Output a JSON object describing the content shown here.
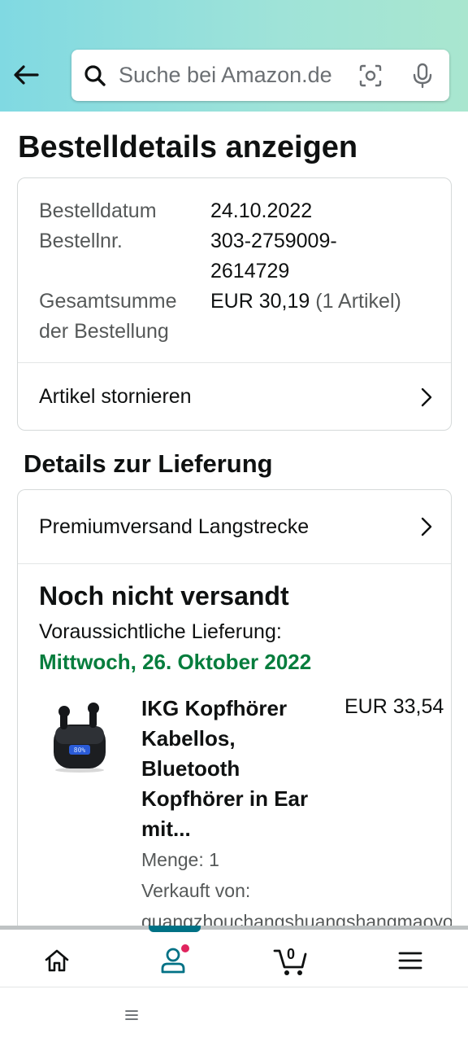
{
  "header": {
    "search_placeholder": "Suche bei Amazon.de"
  },
  "page": {
    "title": "Bestelldetails anzeigen"
  },
  "order_info": {
    "date_label": "Bestelldatum",
    "date_value": "24.10.2022",
    "number_label": "Bestellnr.",
    "number_value_line1": "303-2759009-",
    "number_value_line2": "2614729",
    "total_label_line1": "Gesamtsumme",
    "total_label_line2": "der Bestellung",
    "total_value": "EUR 30,19",
    "total_items": "(1 Artikel)",
    "cancel_label": "Artikel stornieren"
  },
  "delivery": {
    "section_title": "Details zur Lieferung",
    "shipping_method": "Premiumversand Langstrecke",
    "status": "Noch nicht versandt",
    "expected_label": "Voraussichtliche Lieferung:",
    "expected_date": "Mittwoch, 26. Oktober 2022"
  },
  "product": {
    "title": "IKG Kopfhörer Kabellos, Bluetooth Kopfhörer in Ear mit...",
    "price": "EUR 33,54",
    "quantity": "Menge: 1",
    "sold_by_label": "Verkauft von:",
    "seller": "guangzhouchangshuangshangmaoyouxiangongsi"
  },
  "bottom_nav": {
    "cart_count": "0",
    "active": "account"
  },
  "colors": {
    "accent": "#007185",
    "delivery_green": "#067d3d",
    "badge_red": "#e0245e"
  }
}
